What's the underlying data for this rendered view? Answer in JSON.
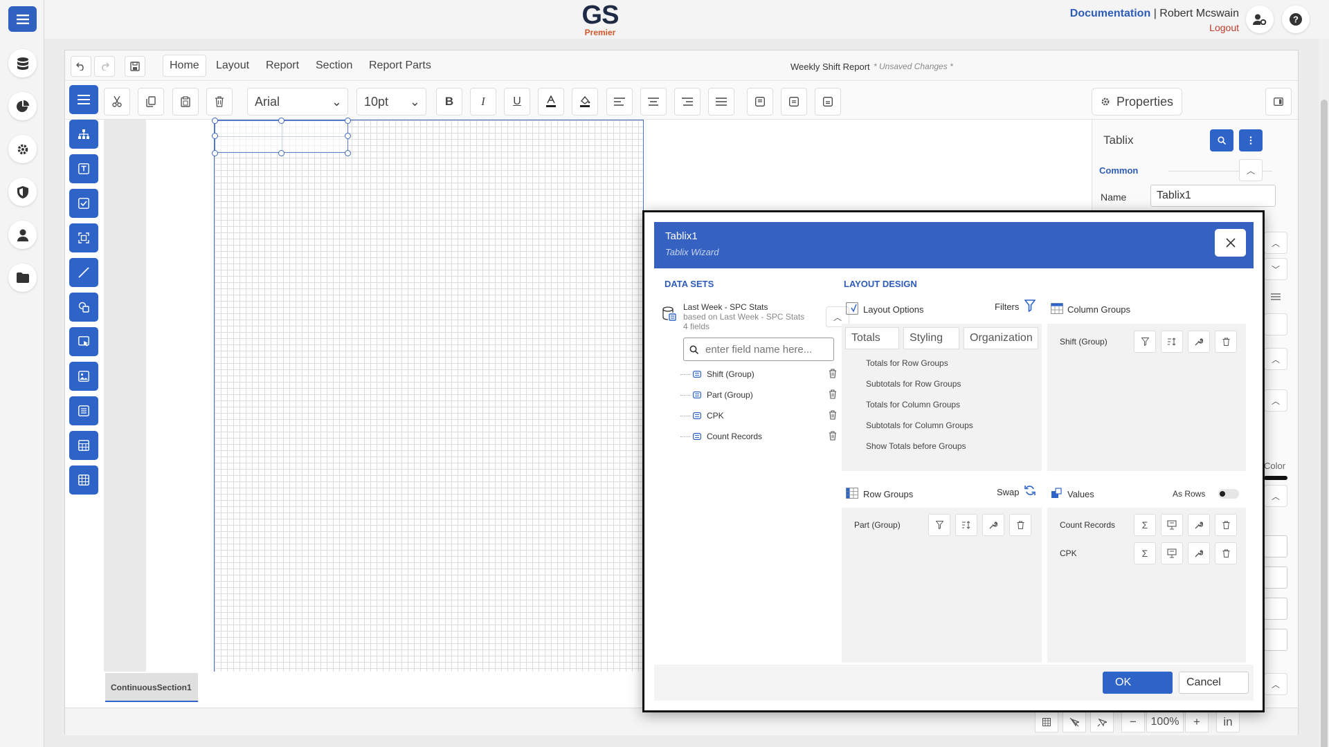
{
  "header": {
    "logo_main": "GS",
    "logo_sub": "Premier",
    "documentation": "Documentation",
    "separator": "|",
    "user": "Robert Mcswain",
    "logout": "Logout"
  },
  "menu": {
    "tabs": [
      "Home",
      "Layout",
      "Report",
      "Section",
      "Report Parts"
    ],
    "doc_title": "Weekly Shift Report",
    "unsaved": "* Unsaved Changes *"
  },
  "toolbar": {
    "font": "Arial",
    "size": "10pt",
    "properties": "Properties"
  },
  "properties": {
    "title": "Tablix",
    "common": "Common",
    "name_label": "Name",
    "name_value": "Tablix1",
    "color_label": "Color"
  },
  "canvas": {
    "section_tab": "ContinuousSection1",
    "zoom": "100%",
    "unit": "in",
    "zoom_out": "−",
    "zoom_in": "+"
  },
  "wizard": {
    "title": "Tablix1",
    "subtitle": "Tablix Wizard",
    "data_sets_heading": "DATA SETS",
    "layout_heading": "LAYOUT DESIGN",
    "dataset": {
      "name": "Last Week - SPC Stats",
      "based_on": "based on Last Week - SPC Stats",
      "fields_count": "4 fields"
    },
    "search_placeholder": "enter field name here...",
    "fields": [
      "Shift (Group)",
      "Part (Group)",
      "CPK",
      "Count Records"
    ],
    "layout_options": {
      "title": "Layout Options",
      "filters": "Filters",
      "tabs": [
        "Totals",
        "Styling",
        "Organization"
      ],
      "items": [
        "Totals for Row Groups",
        "Subtotals for Row Groups",
        "Totals for Column Groups",
        "Subtotals for Column Groups",
        "Show Totals before Groups"
      ]
    },
    "column_groups": {
      "title": "Column Groups",
      "items": [
        "Shift (Group)"
      ]
    },
    "row_groups": {
      "title": "Row Groups",
      "swap": "Swap",
      "items": [
        "Part (Group)"
      ]
    },
    "values": {
      "title": "Values",
      "as_rows": "As Rows",
      "as_rows_on": false,
      "items": [
        "Count Records",
        "CPK"
      ]
    },
    "sigma": "Σ",
    "ok": "OK",
    "cancel": "Cancel"
  },
  "colors": {
    "accent": "#2e63c7",
    "header_blue": "#3561c1",
    "link": "#2d5bb8",
    "logout": "#c0392b",
    "logo_orange": "#d2572a"
  }
}
